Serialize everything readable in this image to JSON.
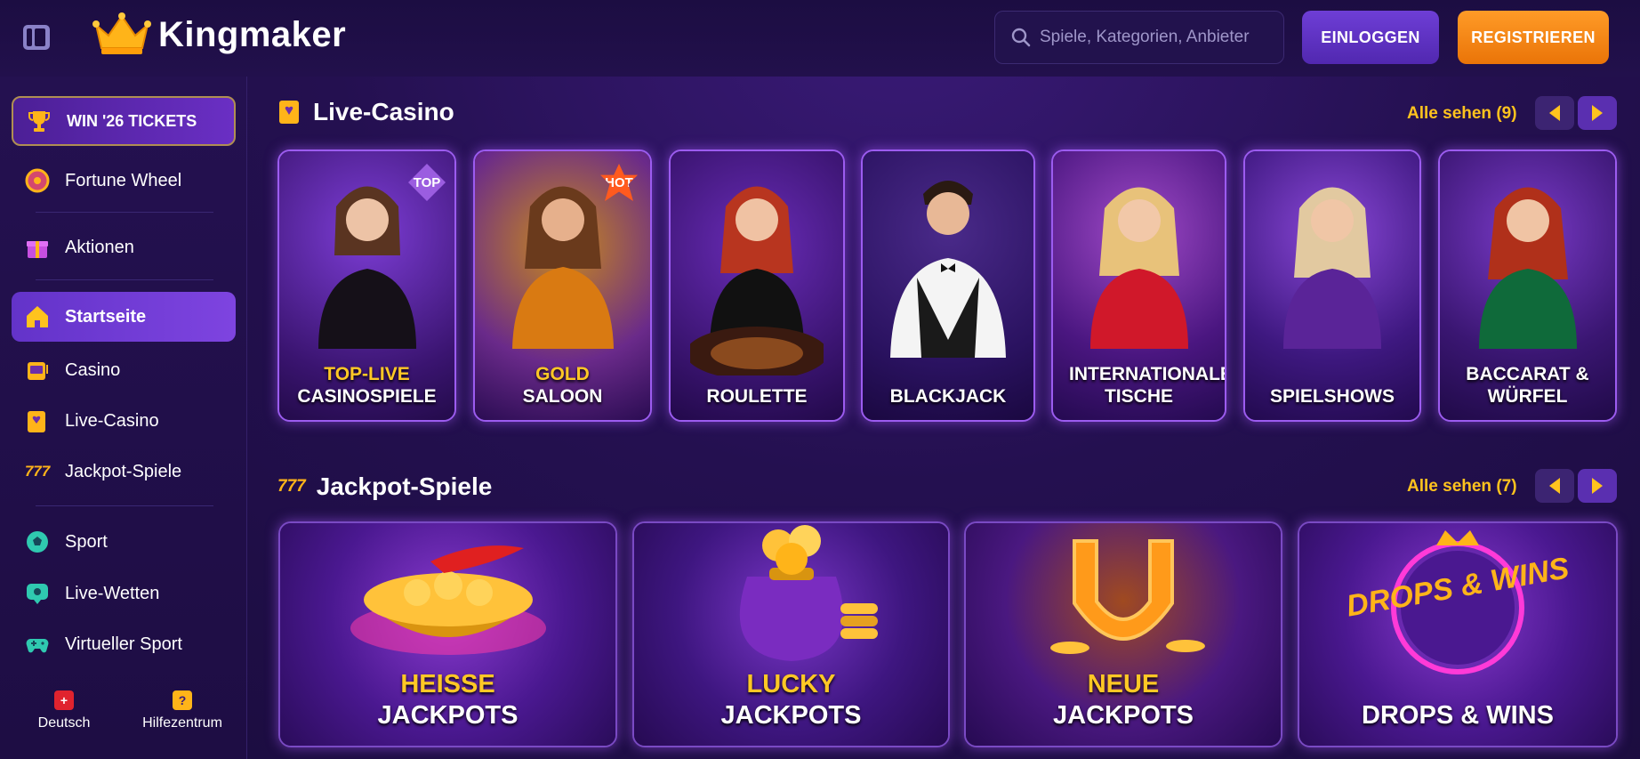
{
  "header": {
    "brand": "Kingmaker",
    "search_placeholder": "Spiele, Kategorien, Anbieter",
    "login_label": "EINLOGGEN",
    "register_label": "REGISTRIEREN"
  },
  "sidebar": {
    "items": [
      {
        "label": "WIN '26 TICKETS",
        "icon": "trophy-icon"
      },
      {
        "label": "Fortune Wheel",
        "icon": "fortune-wheel-icon"
      },
      {
        "label": "Aktionen",
        "icon": "gift-icon"
      },
      {
        "label": "Startseite",
        "icon": "home-icon"
      },
      {
        "label": "Casino",
        "icon": "slot-machine-icon"
      },
      {
        "label": "Live-Casino",
        "icon": "live-casino-icon"
      },
      {
        "label": "Jackpot-Spiele",
        "icon": "777-icon"
      },
      {
        "label": "Sport",
        "icon": "soccer-ball-icon"
      },
      {
        "label": "Live-Wetten",
        "icon": "live-bet-icon"
      },
      {
        "label": "Virtueller Sport",
        "icon": "gamepad-icon"
      }
    ],
    "footer": {
      "language_label": "Deutsch",
      "help_label": "Hilfezentrum"
    }
  },
  "live_casino": {
    "title": "Live-Casino",
    "see_all": "Alle sehen (9)",
    "cards": [
      {
        "top": "TOP-LIVE",
        "bottom": "CASINOSPIELE",
        "badge": "TOP"
      },
      {
        "top": "GOLD",
        "bottom": "SALOON",
        "badge": "HOT"
      },
      {
        "top": "",
        "bottom": "ROULETTE",
        "badge": ""
      },
      {
        "top": "",
        "bottom": "BLACKJACK",
        "badge": ""
      },
      {
        "top": "",
        "bottom": "INTERNATIONALE TISCHE",
        "badge": ""
      },
      {
        "top": "",
        "bottom": "SPIELSHOWS",
        "badge": ""
      },
      {
        "top": "",
        "bottom": "BACCARAT & WÜRFEL",
        "badge": ""
      }
    ]
  },
  "jackpot": {
    "title": "Jackpot-Spiele",
    "see_all": "Alle sehen (7)",
    "cards": [
      {
        "top": "HEISSE",
        "bottom": "JACKPOTS"
      },
      {
        "top": "LUCKY",
        "bottom": "JACKPOTS"
      },
      {
        "top": "NEUE",
        "bottom": "JACKPOTS"
      },
      {
        "top": "",
        "bottom": "DROPS & WINS",
        "logo_text": "DROPS & WINS"
      }
    ]
  },
  "colors": {
    "accent_gold": "#ffc31e",
    "register_orange": "#f5850f",
    "login_purple": "#5f33c2",
    "active_purple": "#7140d6"
  }
}
